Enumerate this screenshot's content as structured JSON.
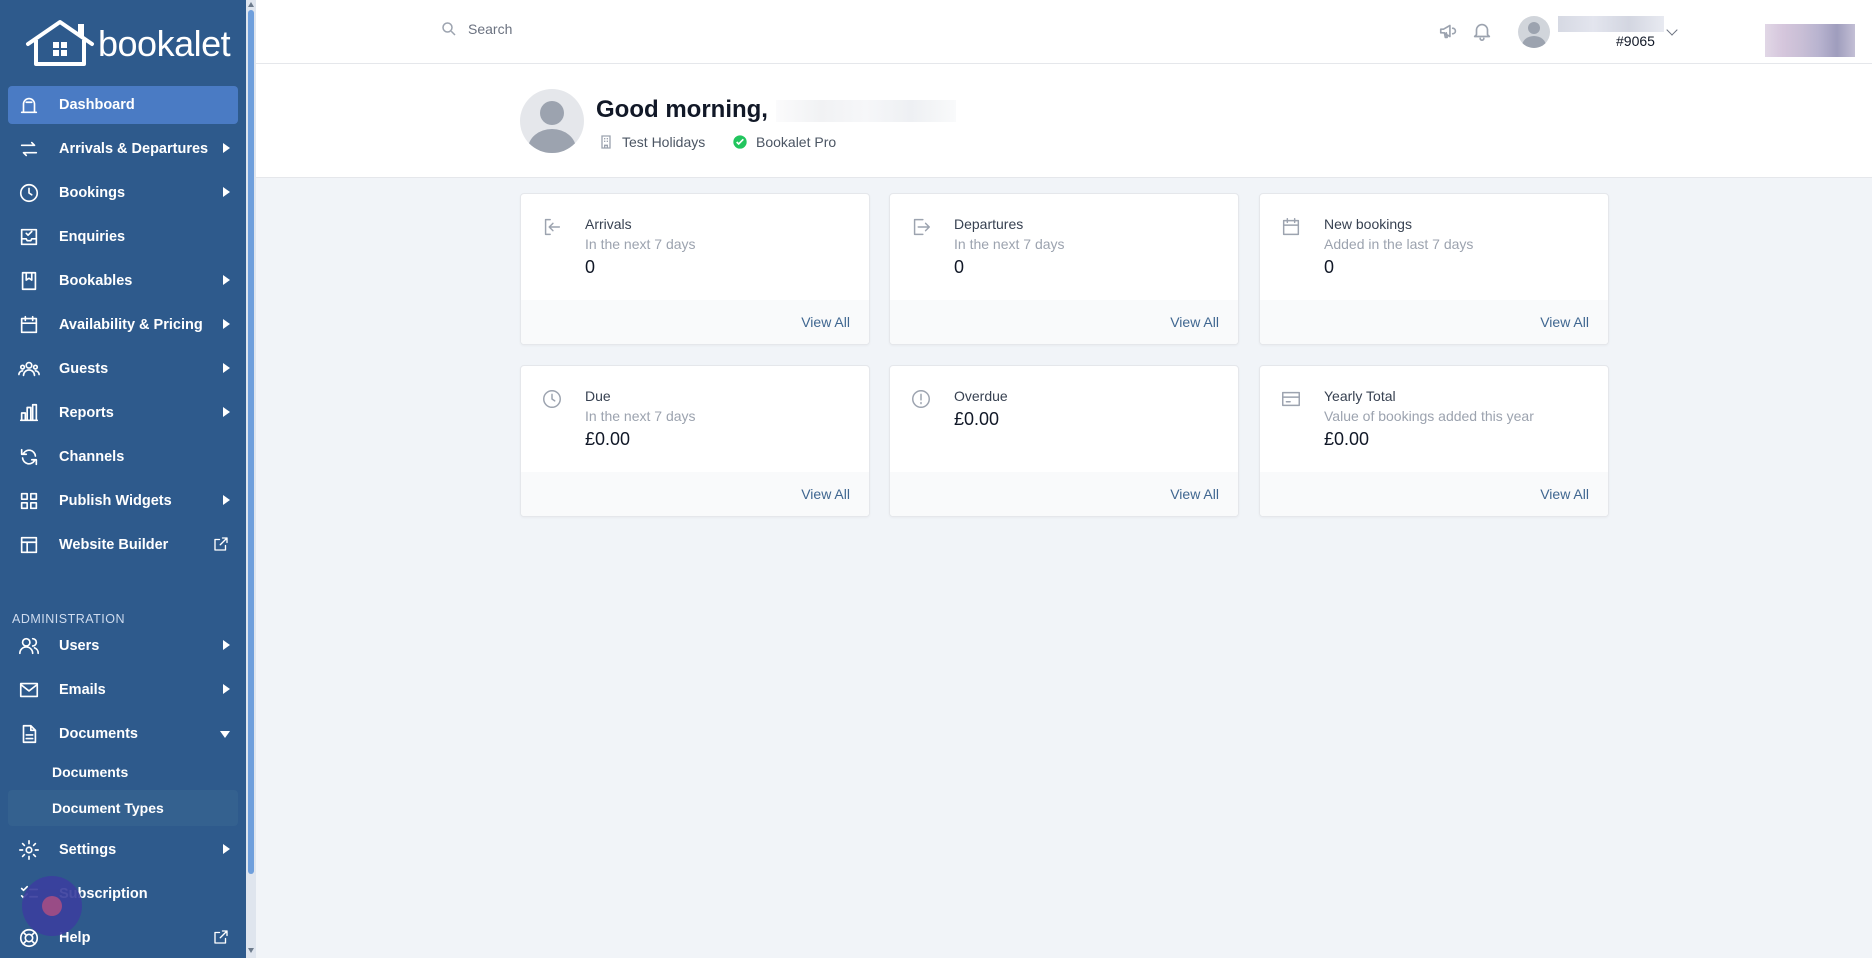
{
  "app": {
    "logo_text": "bookalet"
  },
  "sidebar": {
    "items": [
      {
        "label": "Dashboard"
      },
      {
        "label": "Arrivals & Departures"
      },
      {
        "label": "Bookings"
      },
      {
        "label": "Enquiries"
      },
      {
        "label": "Bookables"
      },
      {
        "label": "Availability & Pricing"
      },
      {
        "label": "Guests"
      },
      {
        "label": "Reports"
      },
      {
        "label": "Channels"
      },
      {
        "label": "Publish Widgets"
      },
      {
        "label": "Website Builder"
      }
    ],
    "admin_label": "ADMINISTRATION",
    "admin_items": [
      {
        "label": "Users"
      },
      {
        "label": "Emails"
      },
      {
        "label": "Documents"
      }
    ],
    "documents_sub": [
      {
        "label": "Documents"
      },
      {
        "label": "Document Types"
      }
    ],
    "bottom_items": [
      {
        "label": "Settings"
      },
      {
        "label": "Subscription"
      },
      {
        "label": "Help"
      }
    ]
  },
  "topbar": {
    "search_placeholder": "Search",
    "user_id": "#9065"
  },
  "header": {
    "greeting": "Good morning,",
    "property": "Test Holidays",
    "plan": "Bookalet Pro"
  },
  "cards": [
    {
      "title": "Arrivals",
      "subtitle": "In the next 7 days",
      "value": "0",
      "link": "View All",
      "icon": "arrival-icon"
    },
    {
      "title": "Departures",
      "subtitle": "In the next 7 days",
      "value": "0",
      "link": "View All",
      "icon": "departure-icon"
    },
    {
      "title": "New bookings",
      "subtitle": "Added in the last 7 days",
      "value": "0",
      "link": "View All",
      "icon": "calendar-icon"
    },
    {
      "title": "Due",
      "subtitle": "In the next 7 days",
      "value": "£0.00",
      "link": "View All",
      "icon": "clock-icon"
    },
    {
      "title": "Overdue",
      "subtitle": "",
      "value": "£0.00",
      "link": "View All",
      "icon": "alert-icon"
    },
    {
      "title": "Yearly Total",
      "subtitle": "Value of bookings added this year",
      "value": "£0.00",
      "link": "View All",
      "icon": "credit-card-icon"
    }
  ],
  "colors": {
    "sidebar_bg": "#2e5a8c",
    "active_item": "#4a7bc4",
    "link": "#3f6690",
    "success": "#22c55e"
  }
}
